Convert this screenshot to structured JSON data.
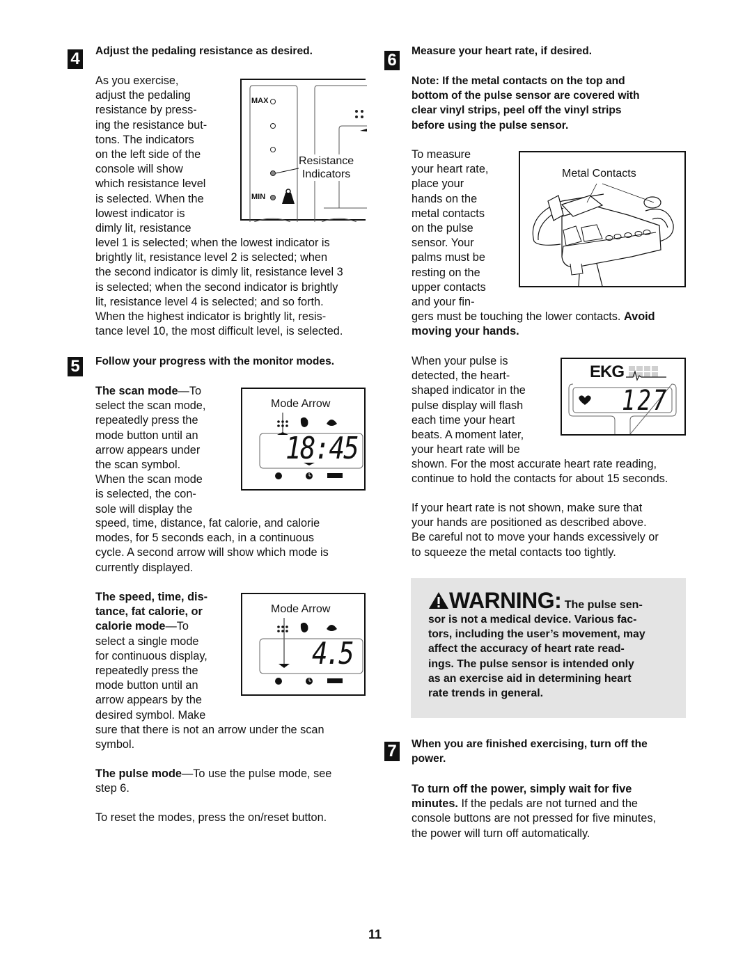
{
  "page_number": "11",
  "steps": [
    {
      "number": "4",
      "heading": "Adjust the pedaling resistance as desired.",
      "wrap_lines": [
        "As you exercise,",
        "adjust the pedaling",
        "resistance by press-",
        "ing the resistance but-",
        "tons. The indicators",
        "on the left side of the",
        "console will show",
        "which resistance level",
        "is selected. When the",
        "lowest indicator is",
        "dimly lit, resistance"
      ],
      "full_lines": [
        "level 1 is selected; when the lowest indicator is",
        "brightly lit, resistance level 2 is selected; when",
        "the second indicator is dimly lit, resistance level 3",
        "is selected; when the second indicator is brightly",
        "lit, resistance level 4 is selected; and so forth.",
        "When the highest indicator is brightly lit, resis-",
        "tance level 10, the most difficult level, is selected."
      ],
      "figure": {
        "max_label": "MAX",
        "min_label": "MIN",
        "callout_lines": [
          "Resistance",
          "Indicators"
        ]
      }
    },
    {
      "number": "5",
      "heading": "Follow your progress with the monitor modes.",
      "scan_mode": {
        "title": "The scan mode",
        "wrap_lines": [
          "—To",
          "select the scan mode,",
          "repeatedly press the",
          "mode button until an",
          "arrow appears under",
          "the scan symbol.",
          "When the scan mode",
          "is selected, the con-",
          "sole will display the"
        ],
        "full_lines": [
          "speed, time, distance, fat calorie, and calorie",
          "modes, for 5 seconds each, in a continuous",
          "cycle. A second arrow will show which mode is",
          "currently displayed."
        ],
        "figure": {
          "label": "Mode Arrow",
          "display_value": "18:45"
        }
      },
      "single_mode": {
        "title_lines": [
          "The speed, time, dis-",
          "tance, fat calorie, or",
          "calorie mode"
        ],
        "title_suffix": "—To",
        "wrap_lines": [
          "select a single mode",
          "for continuous display,",
          "repeatedly press the",
          "mode button until an",
          "arrow appears by the",
          "desired symbol. Make"
        ],
        "full_lines": [
          "sure that there is not an arrow under the scan",
          "symbol."
        ],
        "figure": {
          "label": "Mode Arrow",
          "display_value": "4.5"
        }
      },
      "pulse_mode": {
        "title": "The pulse mode",
        "line1": "—To use the pulse mode, see",
        "line2": "step 6."
      },
      "reset_text": "To reset the modes, press the on/reset button."
    },
    {
      "number": "6",
      "heading": "Measure your heart rate, if desired.",
      "note_lines": [
        "Note: If the metal contacts on the top and",
        "bottom of the pulse sensor are covered with",
        "clear vinyl strips, peel off the vinyl strips",
        "before using the pulse sensor."
      ],
      "measure_wrap_lines": [
        "To measure",
        "your heart rate,",
        "place your",
        "hands on the",
        "metal contacts",
        "on the pulse",
        "sensor. Your",
        "palms must be",
        "resting on the",
        "upper contacts",
        "and your fin-"
      ],
      "measure_full_line1": "gers must be touching the lower contacts. ",
      "measure_full_line1_bold": "Avoid",
      "measure_full_line2_bold": "moving your hands.",
      "contacts_figure_label": "Metal Contacts",
      "pulse_wrap_lines": [
        "When your pulse is",
        "detected, the heart-",
        "shaped indicator in the",
        "pulse display will flash",
        "each time your heart",
        "beats. A moment later,",
        "your heart rate will be"
      ],
      "pulse_full_lines": [
        "shown. For the most accurate heart rate reading,",
        "continue to hold the contacts for about 15 seconds."
      ],
      "ekg_figure": {
        "ekg_label": "EKG",
        "heart_rate": "127"
      },
      "not_shown_lines": [
        "If your heart rate is not shown, make sure that",
        "your hands are positioned as described above.",
        "Be careful not to move your hands excessively or",
        "to squeeze the metal contacts too tightly."
      ],
      "warning": {
        "title": "WARNING:",
        "first_line": " The pulse sen-",
        "lines": [
          "sor is not a medical device. Various fac-",
          "tors, including the user’s movement, may",
          "affect the accuracy of heart rate read-",
          "ings. The pulse sensor is intended only",
          "as an exercise aid in determining heart",
          "rate trends in general."
        ],
        "background": "#e4e4e4"
      }
    },
    {
      "number": "7",
      "heading_lines": [
        "When you are finished exercising, turn off the",
        "power."
      ],
      "bold_lines": [
        "To turn off the power, simply wait for five",
        "minutes."
      ],
      "text_line2_suffix": " If the pedals are not turned and the",
      "text_lines": [
        "console buttons are not pressed for five minutes,",
        "the power will turn off automatically."
      ]
    }
  ]
}
